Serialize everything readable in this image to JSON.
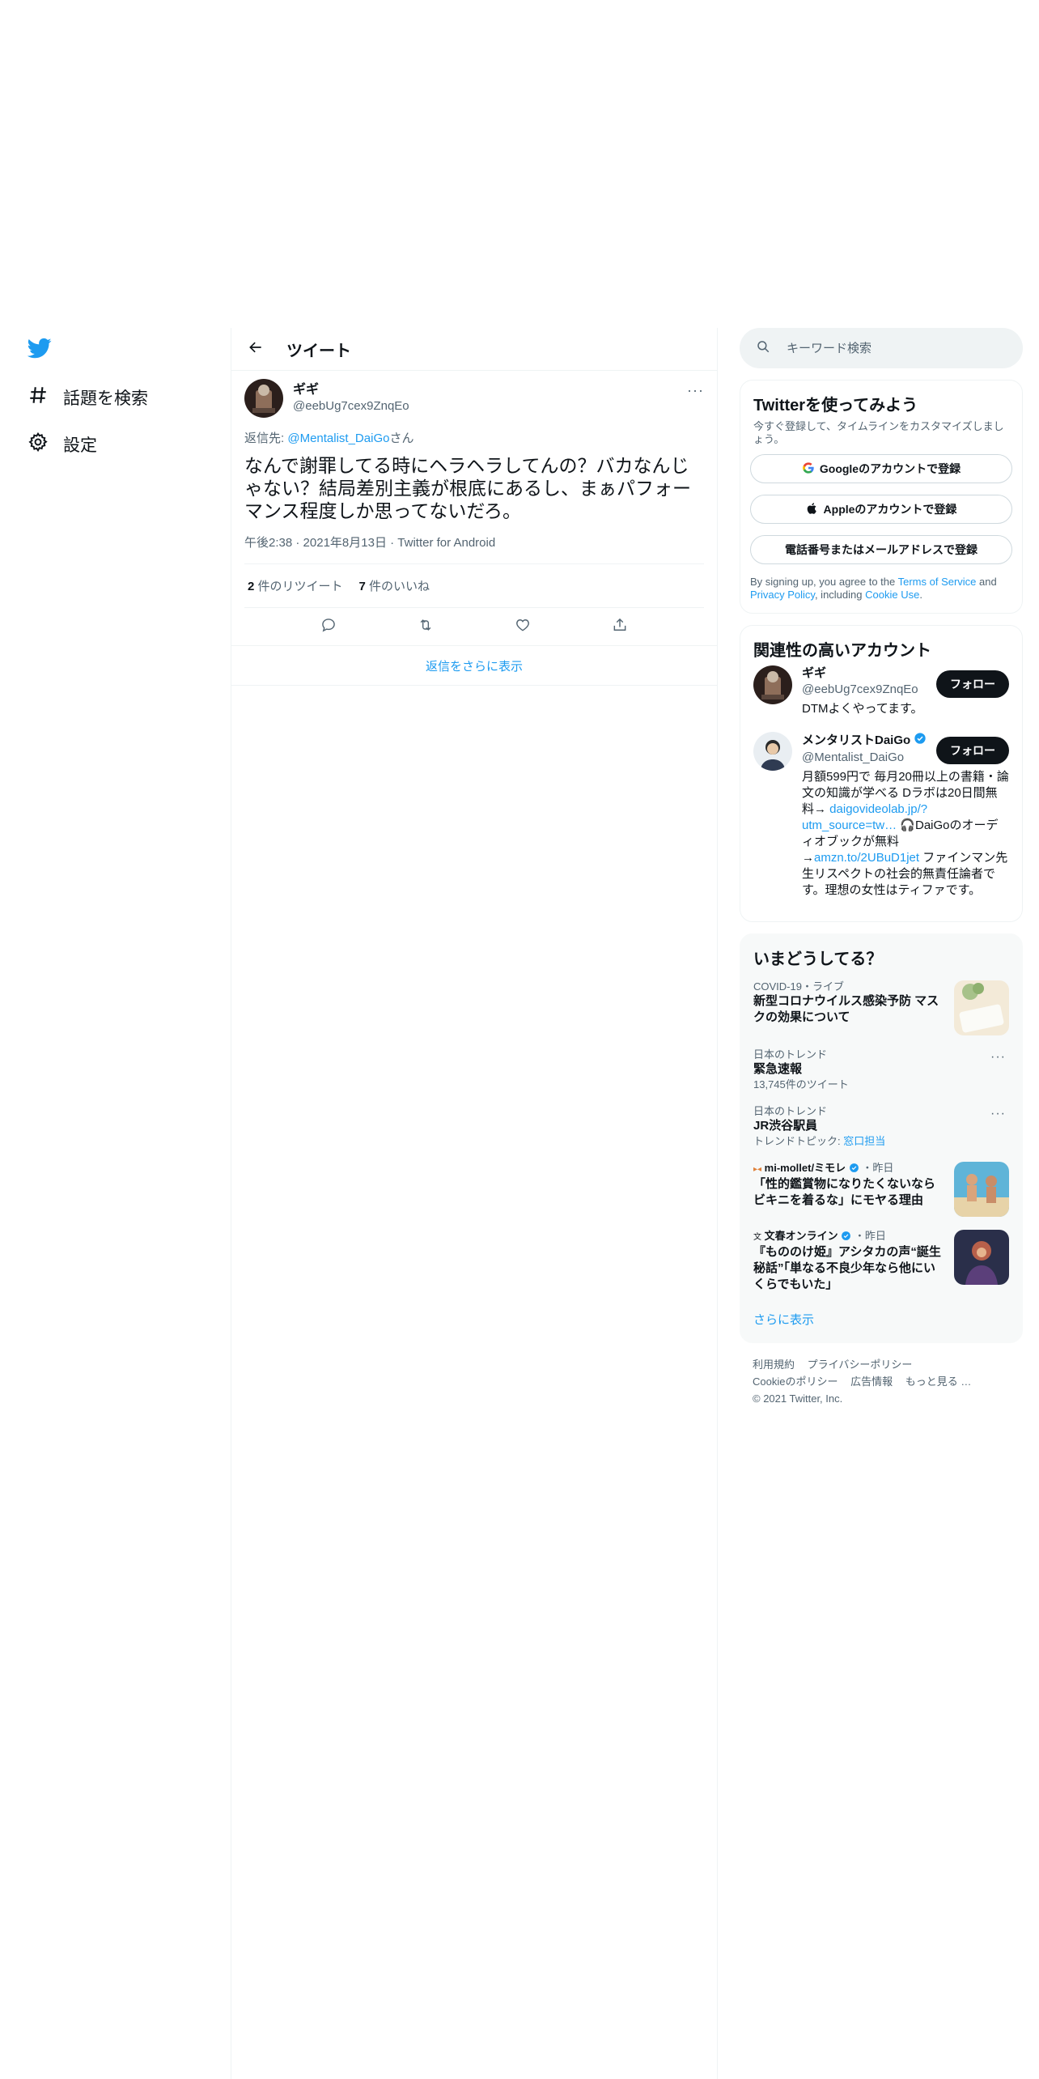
{
  "nav": {
    "explore_label": "話題を検索",
    "settings_label": "設定"
  },
  "main": {
    "header_title": "ツイート",
    "tweet": {
      "display_name": "ギギ",
      "handle": "@eebUg7cex9ZnqEo",
      "reply_prefix": "返信先: ",
      "reply_to": "@Mentalist_DaiGo",
      "reply_suffix": "さん",
      "text": "なんで謝罪してる時にヘラヘラしてんの？バカなんじゃない？結局差別主義が根底にあるし、まぁパフォーマンス程度しか思ってないだろ。",
      "time": "午後2:38",
      "date": "2021年8月13日",
      "source": "Twitter for Android",
      "retweet_count": "2",
      "retweet_label": " 件のリツイート",
      "like_count": "7",
      "like_label": " 件のいいね"
    },
    "show_more_replies": "返信をさらに表示"
  },
  "sidebar": {
    "search_placeholder": "キーワード検索",
    "signup": {
      "title": "Twitterを使ってみよう",
      "subtitle": "今すぐ登録して、タイムラインをカスタマイズしましょう。",
      "google_label": "Googleのアカウントで登録",
      "apple_label": "Appleのアカウントで登録",
      "phone_label": "電話番号またはメールアドレスで登録",
      "terms_1": "By signing up, you agree to the ",
      "terms_tos": "Terms of Service",
      "terms_2": " and ",
      "terms_privacy": "Privacy Policy",
      "terms_3": ", including ",
      "terms_cookie": "Cookie Use",
      "terms_4": "."
    },
    "related": {
      "title": "関連性の高いアカウント",
      "follow_label": "フォロー",
      "accounts": [
        {
          "name": "ギギ",
          "handle": "@eebUg7cex9ZnqEo",
          "bio": "DTMよくやってます。"
        },
        {
          "name": "メンタリストDaiGo",
          "handle": "@Mentalist_DaiGo",
          "bio_1": "月額599円で 毎月20冊以上の書籍・論文の知識が学べる Dラボは20日間無料→ ",
          "bio_link_1": "daigovideolab.jp/?utm_source=tw…",
          "bio_2": " 🎧DaiGoのオーディオブックが無料→",
          "bio_link_2": "amzn.to/2UBuD1jet",
          "bio_3": " ファインマン先生リスペクトの社会的無責任論者です。理想の女性はティファです。"
        }
      ]
    },
    "trends": {
      "title": "いまどうしてる？",
      "items": [
        {
          "context": "COVID-19・ライブ",
          "title": "新型コロナウイルス感染予防 マスクの効果について"
        },
        {
          "context": "日本のトレンド",
          "title": "緊急速報",
          "sub": "13,745件のツイート"
        },
        {
          "context": "日本のトレンド",
          "title": "JR渋谷駅員",
          "sub_prefix": "トレンドトピック: ",
          "sub_link": "窓口担当"
        },
        {
          "source": "mi-mollet/ミモレ",
          "time": "・昨日",
          "title": "「性的鑑賞物になりたくないならビキニを着るな」にモヤる理由"
        },
        {
          "source": "文春オンライン",
          "time": "・昨日",
          "title": "『もののけ姫』アシタカの声“誕生秘話”「単なる不良少年なら他にいくらでもいた」"
        }
      ],
      "show_more": "さらに表示"
    },
    "footer": {
      "terms": "利用規約",
      "privacy": "プライバシーポリシー",
      "cookie": "Cookieのポリシー",
      "ads": "広告情報",
      "more": "もっと見る …",
      "copyright": "© 2021 Twitter, Inc."
    }
  },
  "colors": {
    "accent": "#1d9bf0",
    "text": "#0f1419",
    "muted": "#536471",
    "border": "#eff3f4"
  }
}
